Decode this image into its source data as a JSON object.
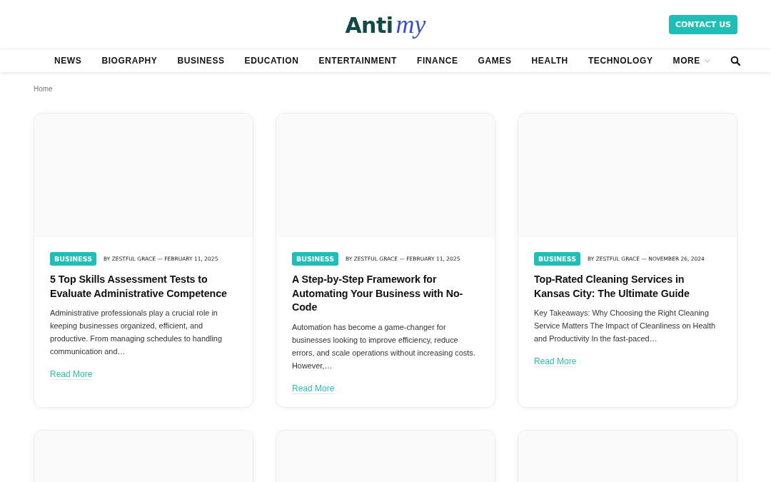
{
  "header": {
    "logo": {
      "part_1": "Anti",
      "part_2": "my"
    },
    "contact_button": "CONTACT US"
  },
  "nav": {
    "items": [
      {
        "label": "NEWS",
        "dropdown": false
      },
      {
        "label": "BIOGRAPHY",
        "dropdown": false
      },
      {
        "label": "BUSINESS",
        "dropdown": false
      },
      {
        "label": "EDUCATION",
        "dropdown": false
      },
      {
        "label": "ENTERTAINMENT",
        "dropdown": false
      },
      {
        "label": "FINANCE",
        "dropdown": false
      },
      {
        "label": "GAMES",
        "dropdown": false
      },
      {
        "label": "HEALTH",
        "dropdown": false
      },
      {
        "label": "TECHNOLOGY",
        "dropdown": false
      },
      {
        "label": "MORE",
        "dropdown": true
      }
    ]
  },
  "breadcrumb": "Home",
  "posts": [
    {
      "kind": "post",
      "category": "BUSINESS",
      "meta": "BY ZESTFUL GRACE — FEBRUARY 11, 2025",
      "title": "5 Top Skills Assessment Tests to Evaluate Administrative Competence",
      "excerpt": "Administrative professionals play a crucial role in keeping businesses organized, efficient, and productive. From managing schedules to handling communication and…",
      "link": "Read More"
    },
    {
      "kind": "post",
      "category": "BUSINESS",
      "meta": "BY ZESTFUL GRACE — FEBRUARY 11, 2025",
      "title": "A Step-by-Step Framework for Automating Your Business with No-Code",
      "excerpt": "Automation has become a game-changer for businesses looking to improve efficiency, reduce errors, and scale operations without increasing costs. However,…",
      "link": "Read More"
    },
    {
      "kind": "post",
      "category": "BUSINESS",
      "meta": "BY ZESTFUL GRACE — NOVEMBER 26, 2024",
      "title": "Top-Rated Cleaning Services in Kansas City: The Ultimate Guide",
      "excerpt": "Key Takeaways: Why Choosing the Right Cleaning Service Matters The Impact of Cleanliness on Health and Productivity In the fast-paced…",
      "link": "Read More"
    },
    {
      "kind": "empty"
    },
    {
      "kind": "empty"
    },
    {
      "kind": "empty"
    }
  ]
}
